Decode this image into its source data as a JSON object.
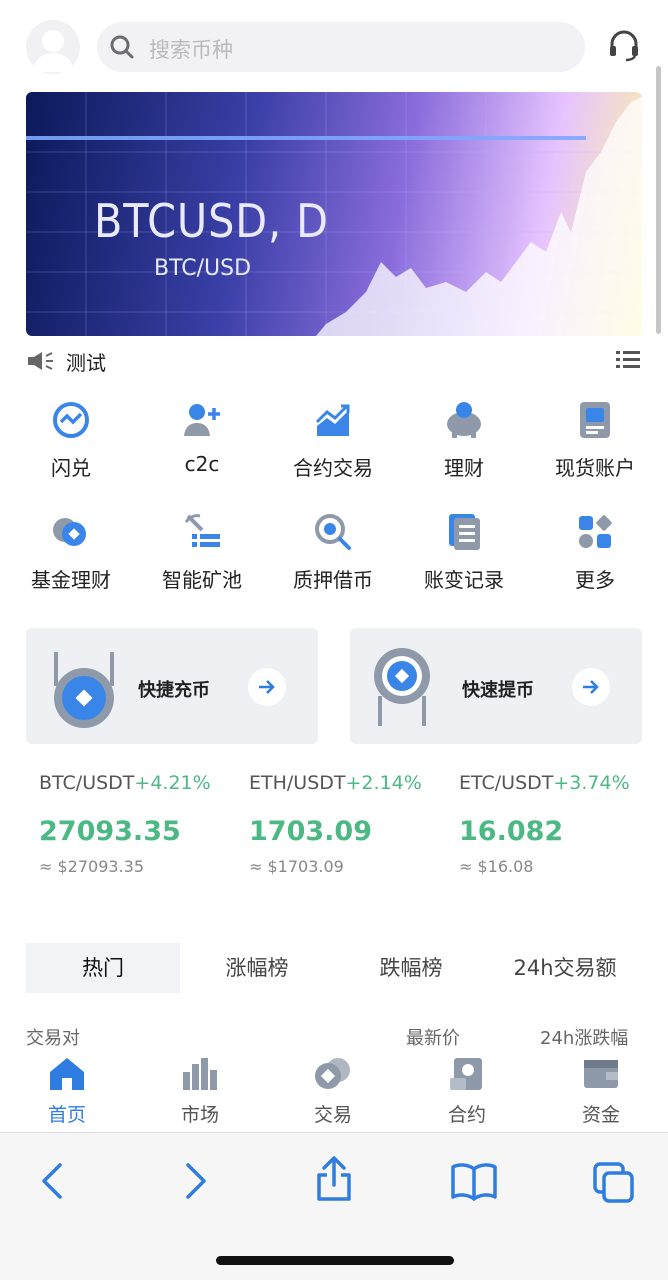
{
  "search": {
    "placeholder": "搜索币种"
  },
  "banner": {
    "title": "BTCUSD, D",
    "subtitle": "BTC/USD"
  },
  "notice": {
    "text": "测试"
  },
  "menu": {
    "row1": [
      {
        "label": "闪兑",
        "icon": "swap-icon"
      },
      {
        "label": "c2c",
        "icon": "add-user-icon"
      },
      {
        "label": "合约交易",
        "icon": "chart-up-icon"
      },
      {
        "label": "理财",
        "icon": "piggy-bank-icon"
      },
      {
        "label": "现货账户",
        "icon": "account-card-icon"
      }
    ],
    "row2": [
      {
        "label": "基金理财",
        "icon": "fund-coins-icon"
      },
      {
        "label": "智能矿池",
        "icon": "mining-icon"
      },
      {
        "label": "质押借币",
        "icon": "pledge-search-icon"
      },
      {
        "label": "账变记录",
        "icon": "records-icon"
      },
      {
        "label": "更多",
        "icon": "more-grid-icon"
      }
    ]
  },
  "quick": {
    "deposit": {
      "label": "快捷充币"
    },
    "withdraw": {
      "label": "快速提币"
    }
  },
  "tickers": [
    {
      "pair": "BTC/USDT",
      "change": "+4.21%",
      "price": "27093.35",
      "approx": "≈ $27093.35"
    },
    {
      "pair": "ETH/USDT",
      "change": "+2.14%",
      "price": "1703.09",
      "approx": "≈ $1703.09"
    },
    {
      "pair": "ETC/USDT",
      "change": "+3.74%",
      "price": "16.082",
      "approx": "≈ $16.08"
    }
  ],
  "tabs": [
    "热门",
    "涨幅榜",
    "跌幅榜",
    "24h交易额"
  ],
  "columns": {
    "pair": "交易对",
    "price": "最新价",
    "change": "24h涨跌幅"
  },
  "nav": [
    {
      "label": "首页",
      "icon": "home-icon"
    },
    {
      "label": "市场",
      "icon": "market-bars-icon"
    },
    {
      "label": "交易",
      "icon": "trade-coins-icon"
    },
    {
      "label": "合约",
      "icon": "contract-icon"
    },
    {
      "label": "资金",
      "icon": "wallet-icon"
    }
  ],
  "colors": {
    "accent": "#2f7de1",
    "up": "#4cb883"
  }
}
